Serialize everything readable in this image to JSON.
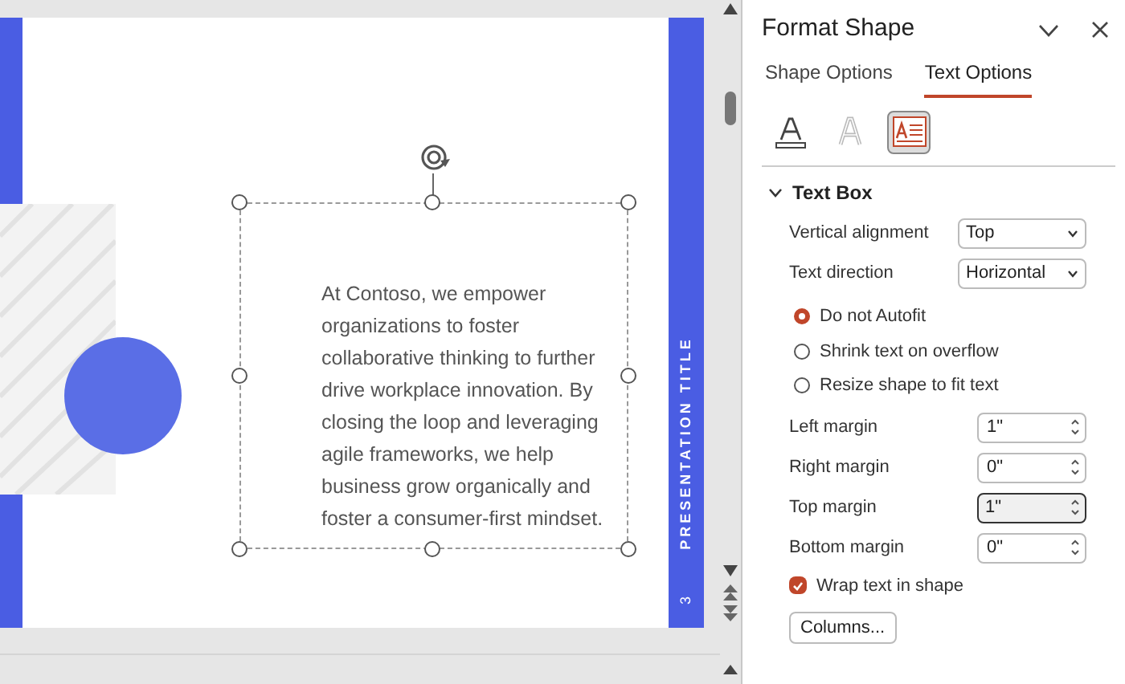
{
  "slide": {
    "body": "At Contoso, we empower organizations to foster collaborative thinking to further drive workplace innovation. By closing the loop and leveraging agile frameworks, we help business grow organically and foster a consumer-first mindset.",
    "side_title": "PRESENTATION TITLE",
    "page_number": "3"
  },
  "pane": {
    "title": "Format Shape",
    "tabs": [
      {
        "label": "Shape Options",
        "selected": false
      },
      {
        "label": "Text Options",
        "selected": true
      }
    ],
    "icon_tabs": [
      {
        "kind": "fill",
        "selected": false
      },
      {
        "kind": "outline",
        "selected": false
      },
      {
        "kind": "textbox",
        "selected": true
      }
    ],
    "section": {
      "title": "Text Box",
      "expanded": true
    },
    "dropdowns": [
      {
        "label": "Vertical alignment",
        "value": "Top"
      },
      {
        "label": "Text direction",
        "value": "Horizontal"
      }
    ],
    "autofit": [
      {
        "label": "Do not Autofit",
        "selected": true
      },
      {
        "label": "Shrink text on overflow",
        "selected": false
      },
      {
        "label": "Resize shape to fit text",
        "selected": false
      }
    ],
    "margins": [
      {
        "label": "Left margin",
        "value": "1\"",
        "focused": false
      },
      {
        "label": "Right margin",
        "value": "0\"",
        "focused": false
      },
      {
        "label": "Top margin",
        "value": "1\"",
        "focused": true
      },
      {
        "label": "Bottom margin",
        "value": "0\"",
        "focused": false
      }
    ],
    "wrap": {
      "label": "Wrap text in shape",
      "checked": true
    },
    "columns_button": "Columns..."
  }
}
